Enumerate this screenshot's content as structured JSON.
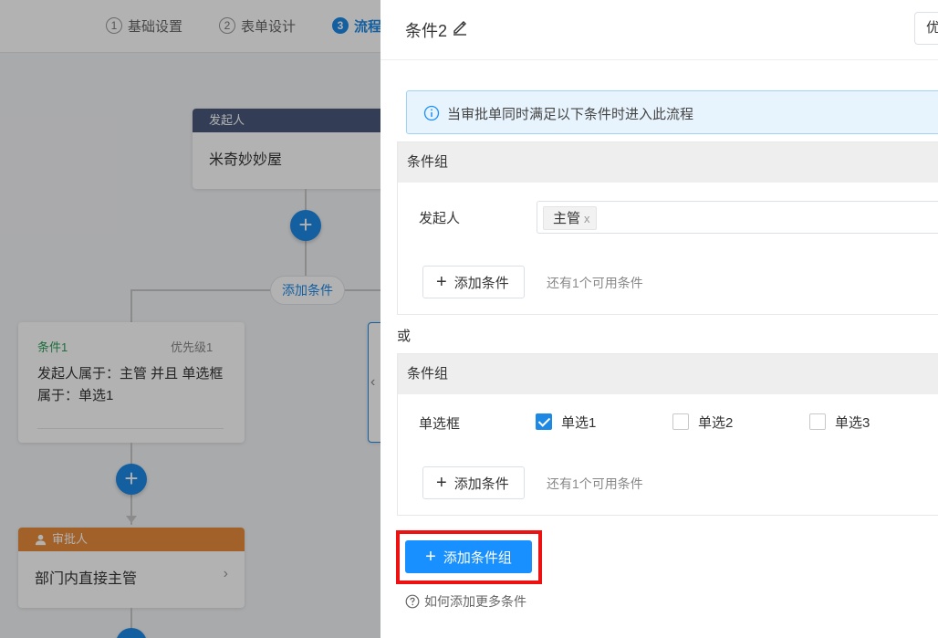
{
  "steps": [
    {
      "num": "1",
      "label": "基础设置"
    },
    {
      "num": "2",
      "label": "表单设计"
    },
    {
      "num": "3",
      "label": "流程"
    }
  ],
  "flow": {
    "initiator": {
      "header": "发起人",
      "body": "米奇妙妙屋"
    },
    "add_condition_pill": "添加条件",
    "condition1": {
      "title": "条件1",
      "priority": "优先级1",
      "desc": "发起人属于：主管 并且 单选框属于：单选1"
    },
    "approver": {
      "header": "审批人",
      "body": "部门内直接主管"
    }
  },
  "drawer": {
    "title": "条件2",
    "priority_value": "优",
    "info_text": "当审批单同时满足以下条件时进入此流程",
    "group_title": "条件组",
    "or_label": "或",
    "group1": {
      "field_label": "发起人",
      "tag": "主管",
      "tag_close": "x",
      "add_condition": "添加条件",
      "hint": "还有1个可用条件"
    },
    "group2": {
      "field_label": "单选框",
      "options": [
        {
          "label": "单选1",
          "checked": true
        },
        {
          "label": "单选2",
          "checked": false
        },
        {
          "label": "单选3",
          "checked": false
        }
      ],
      "add_condition": "添加条件",
      "hint": "还有1个可用条件"
    },
    "add_group_button": "添加条件组",
    "help_link": "如何添加更多条件"
  },
  "colors": {
    "accent": "#1e88e5",
    "primary_button": "#1890ff",
    "initiator_header": "#4a5a7c",
    "approver_header": "#e88c3a",
    "condition_title": "#2e9e5b",
    "highlight": "#ee1111"
  }
}
